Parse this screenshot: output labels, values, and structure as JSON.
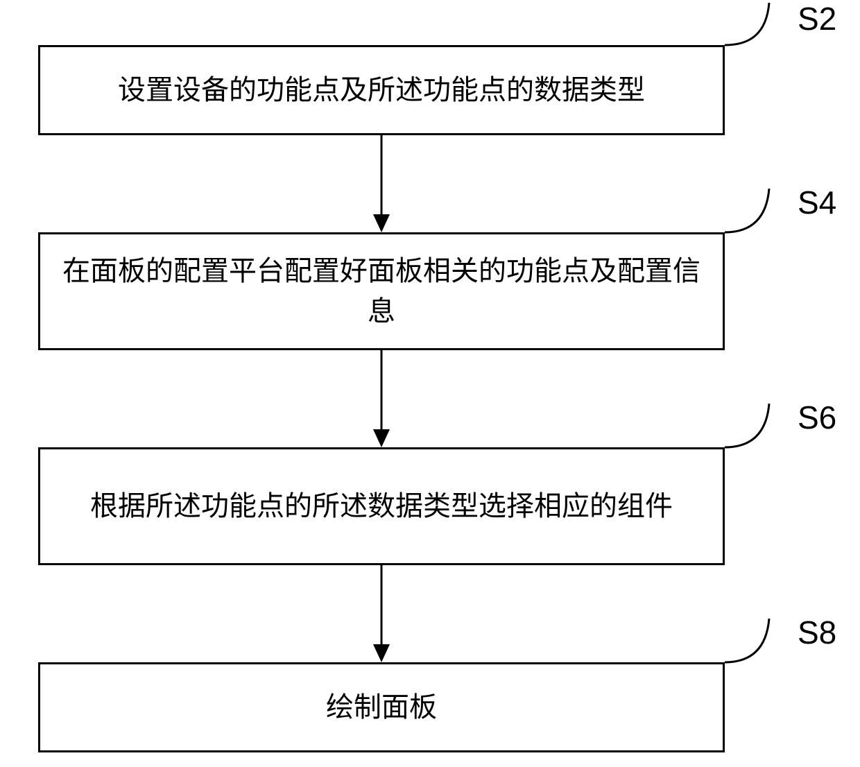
{
  "diagram": {
    "steps": [
      {
        "id": "S2",
        "label": "S2",
        "text": "设置设备的功能点及所述功能点的数据类型"
      },
      {
        "id": "S4",
        "label": "S4",
        "text": "在面板的配置平台配置好面板相关的功能点及配置信息"
      },
      {
        "id": "S6",
        "label": "S6",
        "text": "根据所述功能点的所述数据类型选择相应的组件"
      },
      {
        "id": "S8",
        "label": "S8",
        "text": "绘制面板"
      }
    ]
  }
}
